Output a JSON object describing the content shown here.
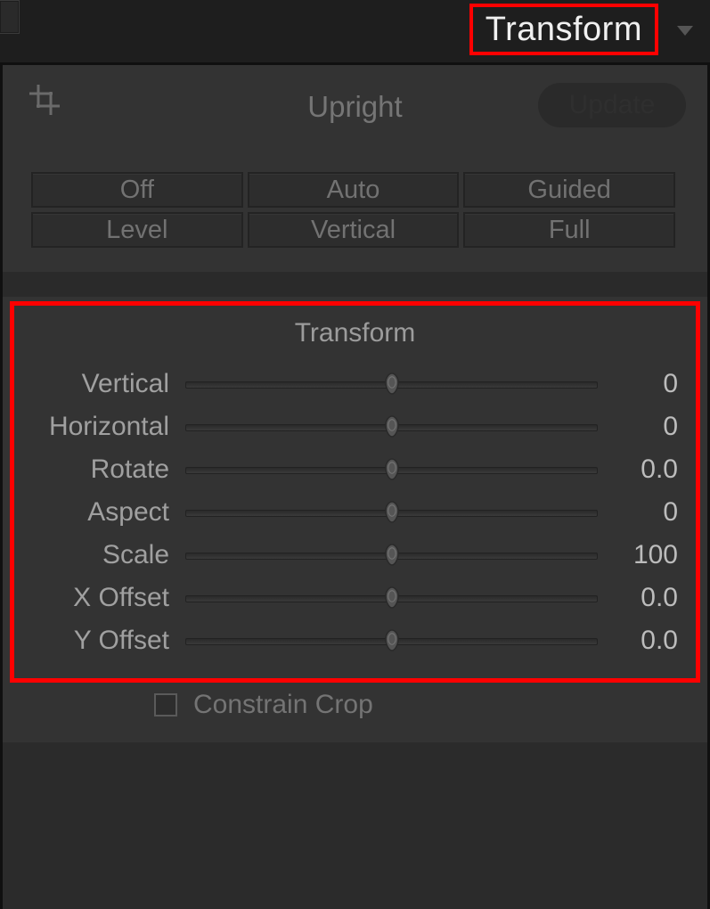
{
  "panel": {
    "title": "Transform"
  },
  "upright": {
    "label": "Upright",
    "update_label": "Update",
    "modes": {
      "off": "Off",
      "auto": "Auto",
      "guided": "Guided",
      "level": "Level",
      "vertical": "Vertical",
      "full": "Full"
    }
  },
  "transform": {
    "section_title": "Transform",
    "sliders": [
      {
        "key": "vertical",
        "label": "Vertical",
        "value": "0"
      },
      {
        "key": "horizontal",
        "label": "Horizontal",
        "value": "0"
      },
      {
        "key": "rotate",
        "label": "Rotate",
        "value": "0.0"
      },
      {
        "key": "aspect",
        "label": "Aspect",
        "value": "0"
      },
      {
        "key": "scale",
        "label": "Scale",
        "value": "100"
      },
      {
        "key": "xoffset",
        "label": "X Offset",
        "value": "0.0"
      },
      {
        "key": "yoffset",
        "label": "Y Offset",
        "value": "0.0"
      }
    ]
  },
  "constrain": {
    "label": "Constrain Crop",
    "checked": false
  }
}
